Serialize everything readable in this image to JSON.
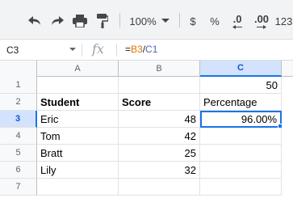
{
  "toolbar": {
    "zoom": "100%",
    "currency": "$",
    "percent": "%",
    "decrease_decimal": ".0",
    "increase_decimal": ".00",
    "more_formats": "123"
  },
  "formula_bar": {
    "name_box": "C3",
    "fx": "fx",
    "formula_prefix": "=",
    "formula_ref1": "B3",
    "formula_op": "/",
    "formula_ref2": "C1"
  },
  "columns": [
    "A",
    "B",
    "C"
  ],
  "rows": [
    "1",
    "2",
    "3",
    "4",
    "5",
    "6",
    "7"
  ],
  "cells": {
    "C1": "50",
    "A2": "Student",
    "B2": "Score",
    "C2": "Percentage",
    "A3": "Eric",
    "B3": "48",
    "C3": "96.00%",
    "A4": "Tom",
    "B4": "42",
    "A5": "Bratt",
    "B5": "25",
    "A6": "Lily",
    "B6": "32"
  },
  "colors": {
    "selection": "#1a73e8",
    "ref_b3": "#e37400",
    "ref_c1": "#4c67b8"
  }
}
